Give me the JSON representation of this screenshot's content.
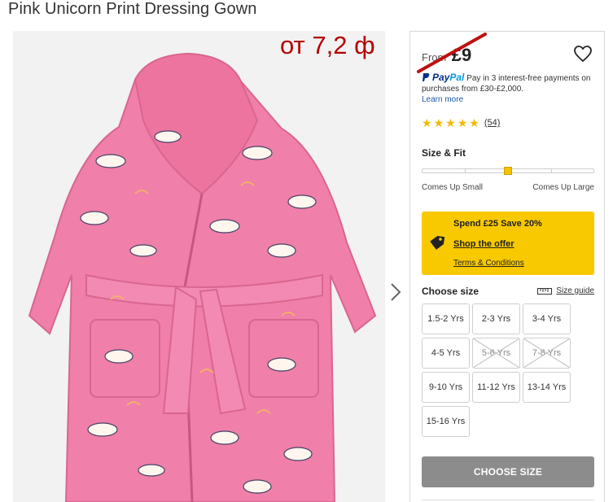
{
  "product": {
    "title": "Pink Unicorn Print Dressing Gown"
  },
  "overlay": {
    "price_text": "от 7,2 ф"
  },
  "pricing": {
    "from_label": "From",
    "price": "£9"
  },
  "paypal": {
    "logo_pay": "Pay",
    "logo_pal": "Pal",
    "text": "Pay in 3 interest-free payments on purchases from £30-£2,000.",
    "learn_more": "Learn more"
  },
  "rating": {
    "stars": 5,
    "count": "(54)"
  },
  "size_fit": {
    "heading": "Size & Fit",
    "left_label": "Comes Up Small",
    "right_label": "Comes Up Large",
    "position_fraction": 0.5
  },
  "promo": {
    "title": "Spend £25 Save 20%",
    "shop_link": "Shop the offer",
    "terms_link": "Terms & Conditions"
  },
  "size_chooser": {
    "heading": "Choose size",
    "guide_label": "Size guide",
    "sizes": [
      {
        "label": "1.5-2 Yrs",
        "available": true
      },
      {
        "label": "2-3 Yrs",
        "available": true
      },
      {
        "label": "3-4 Yrs",
        "available": true
      },
      {
        "label": "4-5 Yrs",
        "available": true
      },
      {
        "label": "5-6 Yrs",
        "available": false
      },
      {
        "label": "7-8 Yrs",
        "available": false
      },
      {
        "label": "9-10 Yrs",
        "available": true
      },
      {
        "label": "11-12 Yrs",
        "available": true
      },
      {
        "label": "13-14 Yrs",
        "available": true
      },
      {
        "label": "15-16 Yrs",
        "available": true
      }
    ]
  },
  "cta": {
    "label": "CHOOSE SIZE"
  },
  "colors": {
    "gown_pink": "#f07fa9",
    "promo_yellow": "#f9c900",
    "overlay_red": "#b40000",
    "cta_grey": "#8c8c8c"
  }
}
